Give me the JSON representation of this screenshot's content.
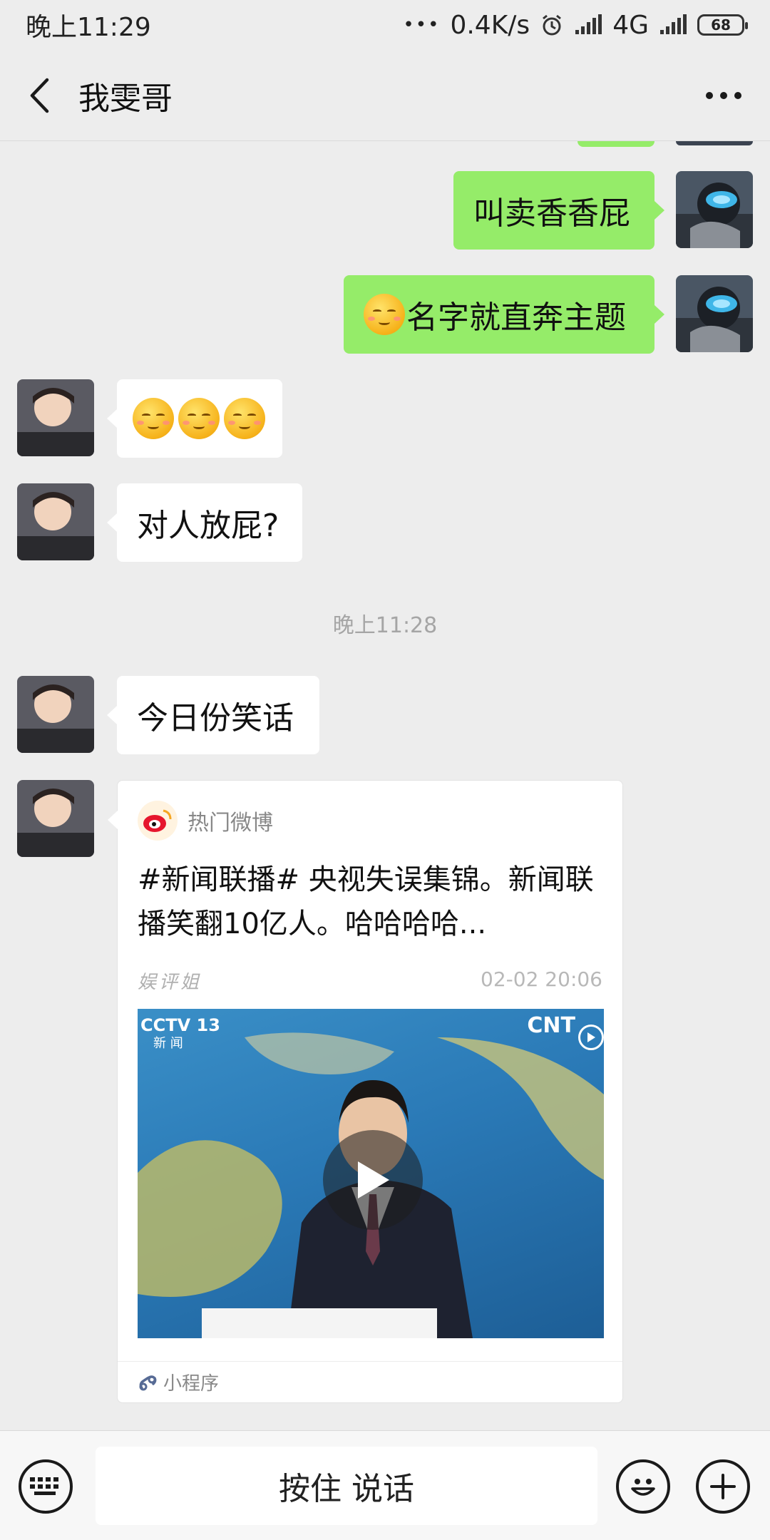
{
  "status_bar": {
    "time": "晚上11:29",
    "dots": "•••",
    "speed": "0.4K/s",
    "network": "4G",
    "battery": "68"
  },
  "header": {
    "title": "我雯哥"
  },
  "messages": [
    {
      "from": "me",
      "text": "叫卖香香屁"
    },
    {
      "from": "me",
      "text": "名字就直奔主题",
      "emoji": "smirk-face"
    },
    {
      "from": "friend",
      "emoji_count": 3,
      "emoji": "relieved-face"
    },
    {
      "from": "friend",
      "text": "对人放屁?"
    },
    {
      "from": "friend",
      "text": "今日份笑话"
    }
  ],
  "timestamp": "晚上11:28",
  "card": {
    "source": "热门微博",
    "title": "#新闻联播# 央视失误集锦。新闻联播笑翻10亿人。哈哈哈哈...",
    "author": "娱评姐",
    "date": "02-02 20:06",
    "video_channel": "CCTV 13",
    "video_sub": "新 闻",
    "video_watermark": "CNT",
    "footer": "小程序"
  },
  "input_bar": {
    "talk_label": "按住 说话"
  },
  "colors": {
    "outgoing_bubble": "#95ec69",
    "incoming_bubble": "#ffffff",
    "background": "#ededed"
  }
}
